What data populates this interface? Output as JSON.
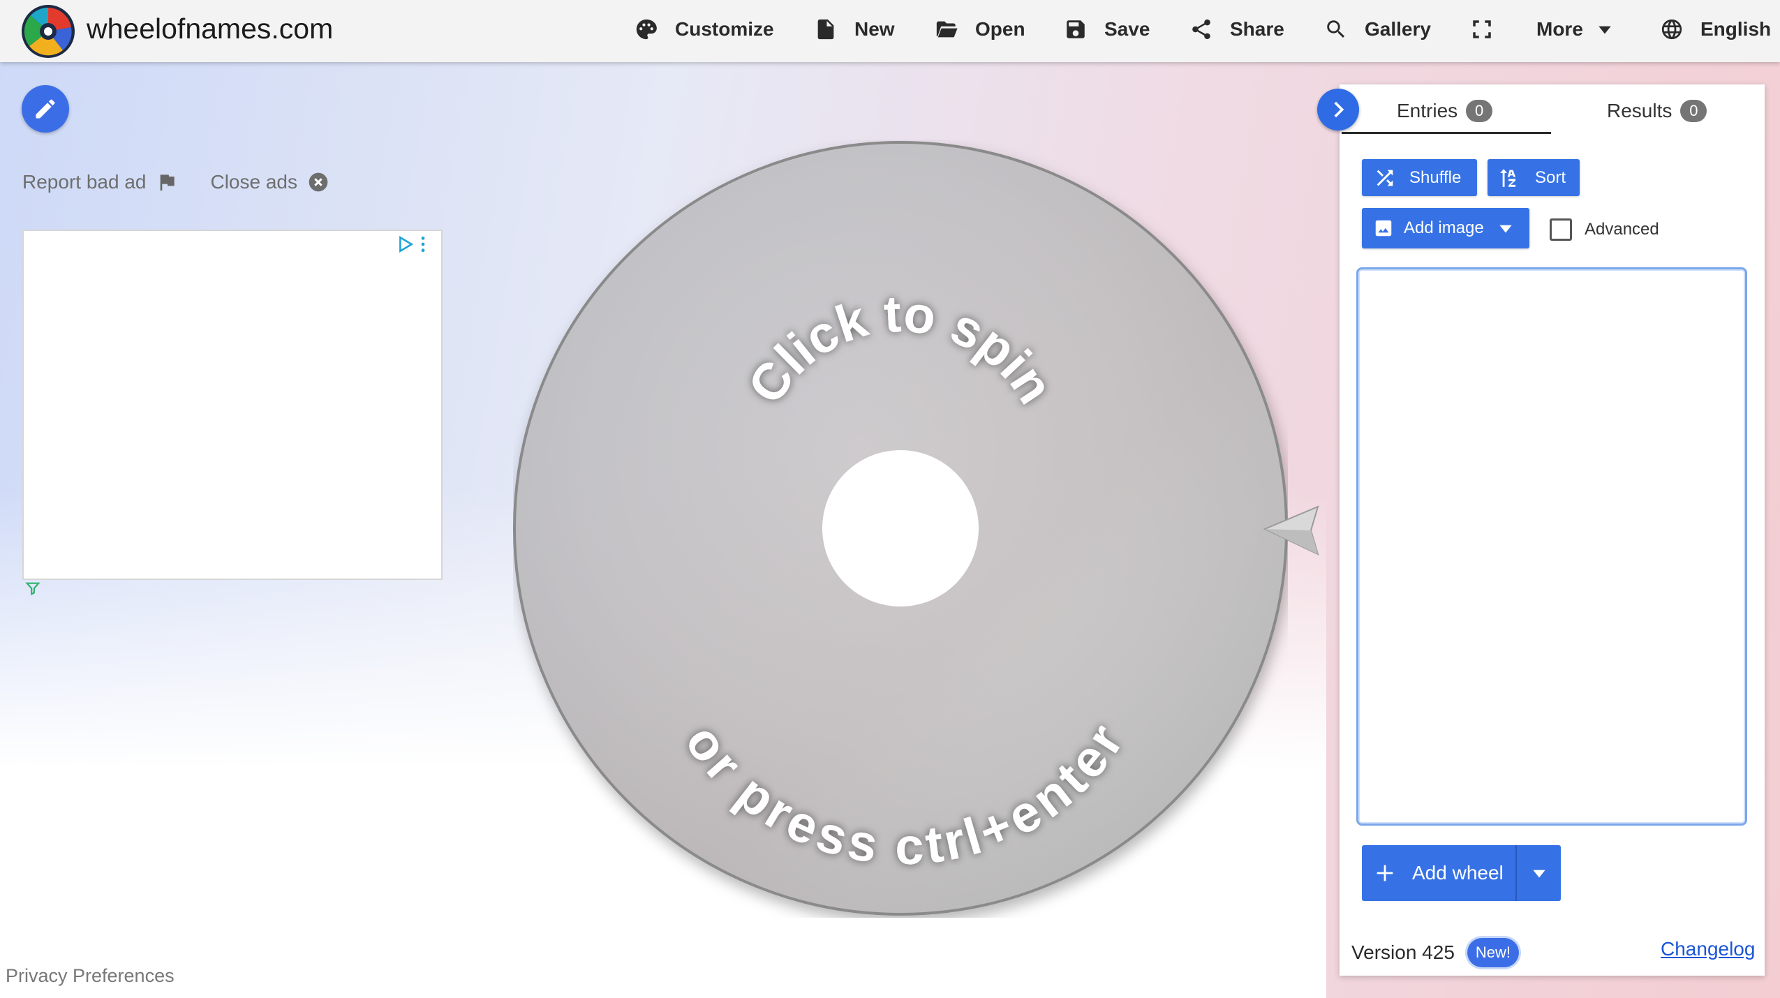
{
  "header": {
    "site_title": "wheelofnames.com",
    "nav": [
      {
        "label": "Customize",
        "icon": "palette-icon"
      },
      {
        "label": "New",
        "icon": "file-icon"
      },
      {
        "label": "Open",
        "icon": "folder-open-icon"
      },
      {
        "label": "Save",
        "icon": "save-icon"
      },
      {
        "label": "Share",
        "icon": "share-icon"
      },
      {
        "label": "Gallery",
        "icon": "search-icon"
      },
      {
        "label": "",
        "icon": "fullscreen-icon"
      },
      {
        "label": "More",
        "icon": "caret-down-icon"
      },
      {
        "label": "English",
        "icon": "globe-icon"
      }
    ]
  },
  "left": {
    "report_ad": "Report bad ad",
    "close_ads": "Close ads",
    "privacy": "Privacy Preferences"
  },
  "wheel": {
    "line1": "Click to spin",
    "line2": "or press ctrl+enter"
  },
  "panel": {
    "tabs": [
      {
        "label": "Entries",
        "count": "0"
      },
      {
        "label": "Results",
        "count": "0"
      }
    ],
    "shuffle": "Shuffle",
    "sort": "Sort",
    "add_image": "Add image",
    "advanced": "Advanced",
    "add_wheel": "Add wheel",
    "version": "Version 425",
    "new_badge": "New!",
    "changelog": "Changelog"
  },
  "colors": {
    "accent": "#3672e5",
    "wheel": "#c9c9c9"
  }
}
